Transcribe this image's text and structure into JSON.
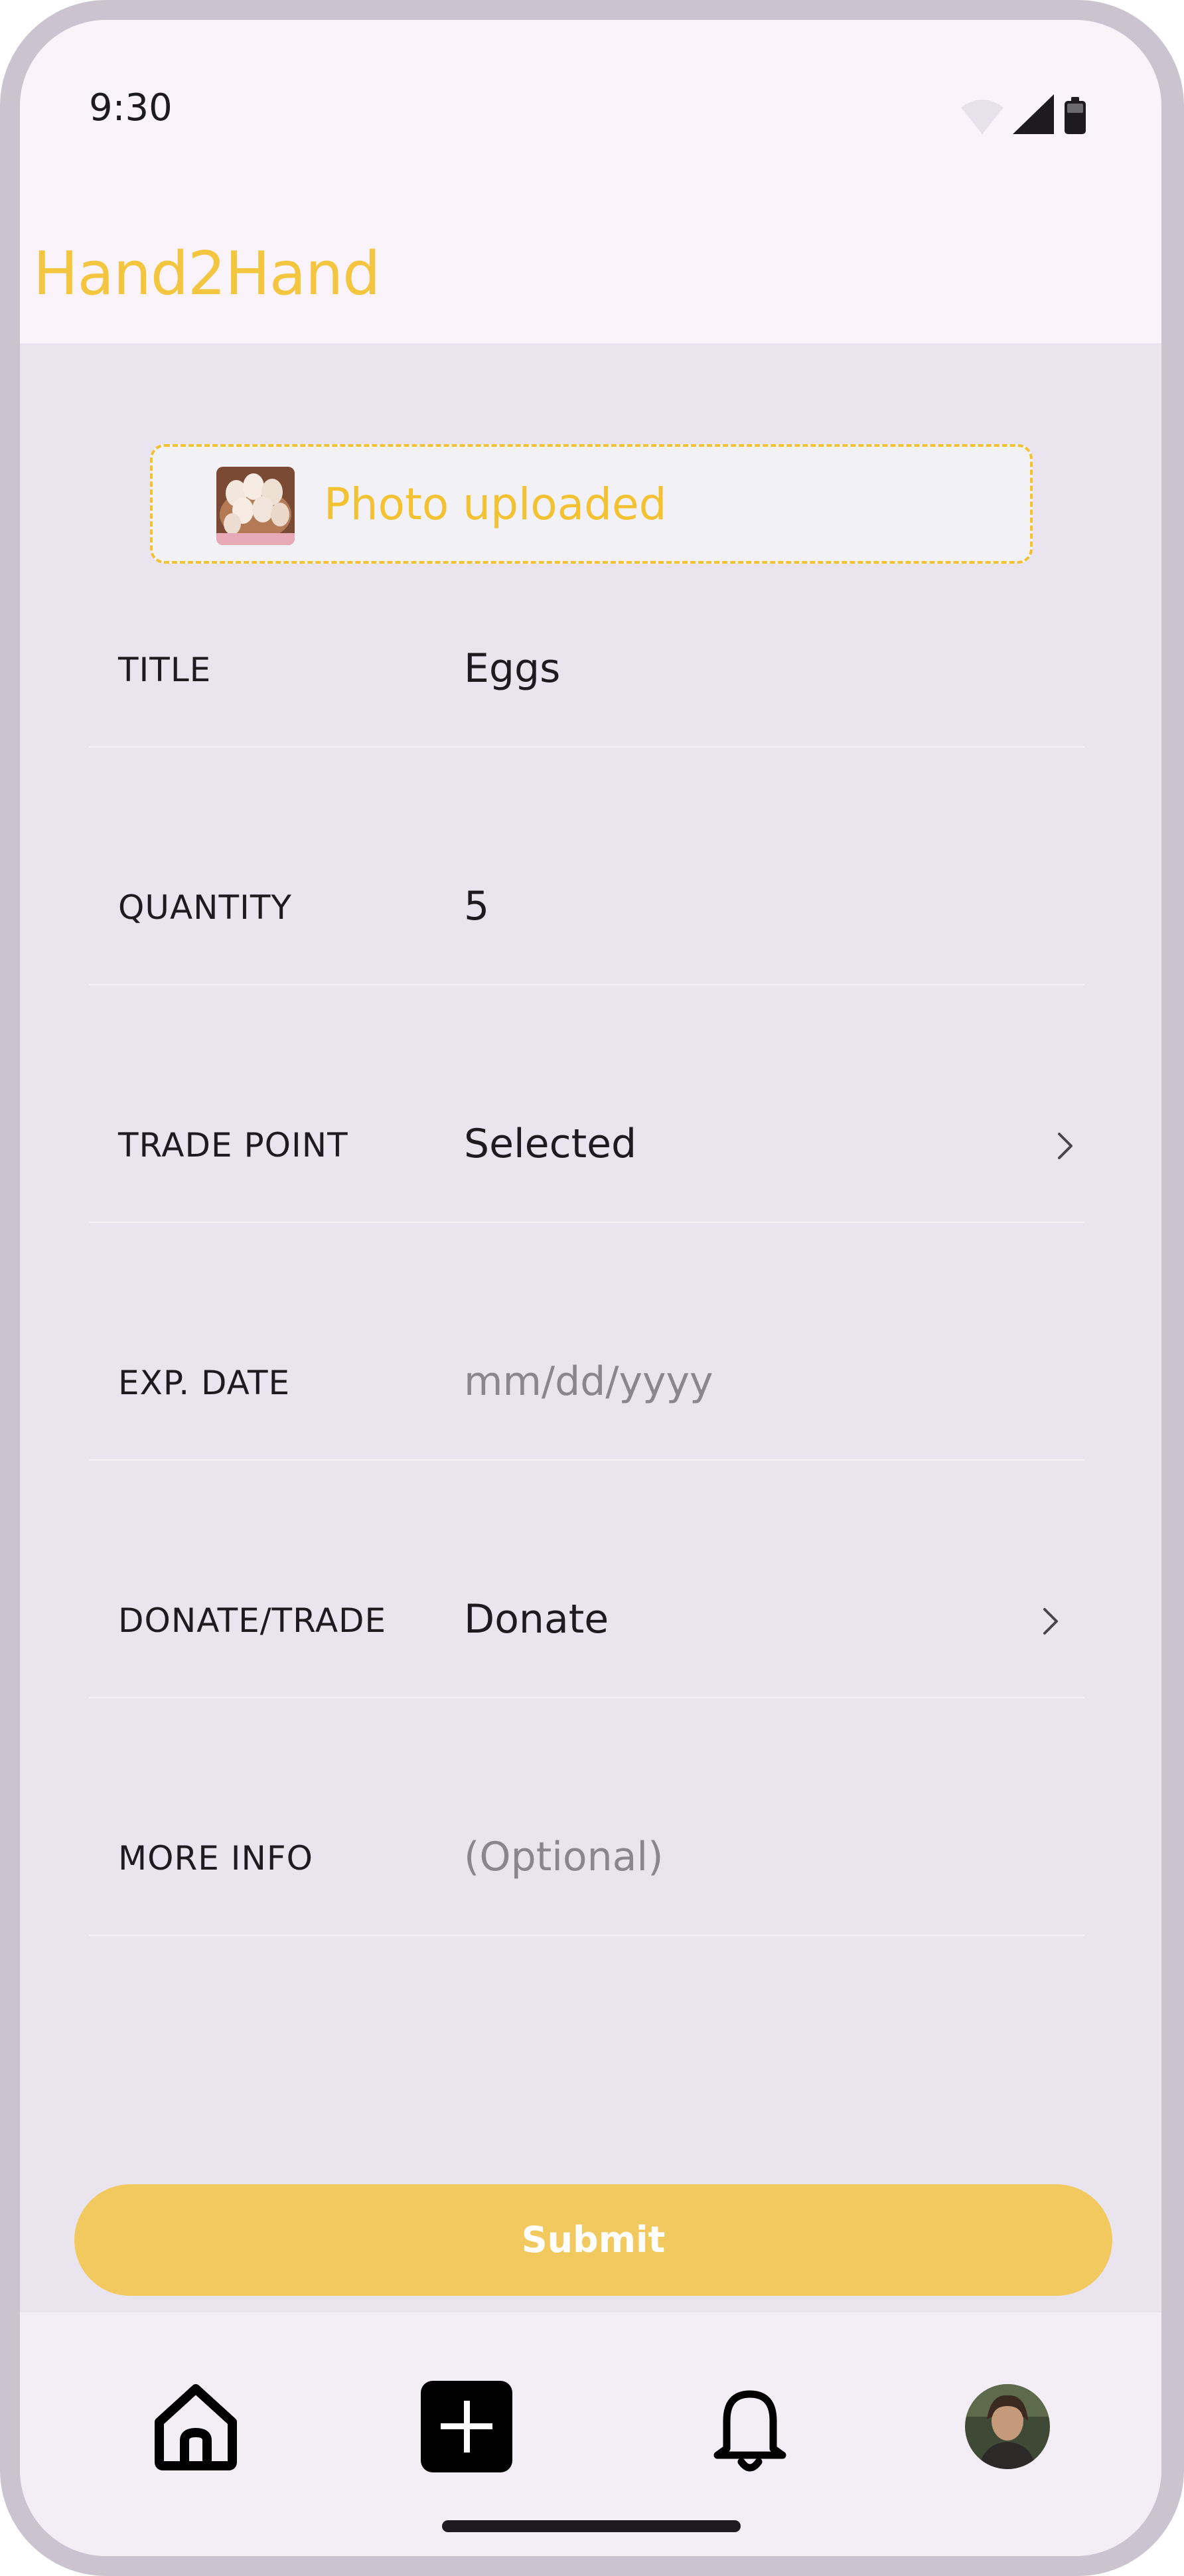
{
  "status_bar": {
    "time": "9:30",
    "icons": [
      "wifi-icon",
      "signal-icon",
      "battery-icon"
    ]
  },
  "app_bar": {
    "title": "Hand2Hand"
  },
  "upload": {
    "label": "Photo uploaded",
    "thumbnail": "eggs-photo"
  },
  "form": {
    "rows": [
      {
        "label": "TITLE",
        "value": "Eggs",
        "placeholder": false,
        "chevron": false
      },
      {
        "label": "QUANTITY",
        "value": "5",
        "placeholder": false,
        "chevron": false
      },
      {
        "label": "TRADE POINT",
        "value": "Selected",
        "placeholder": false,
        "chevron": true
      },
      {
        "label": "EXP. DATE",
        "value": "mm/dd/yyyy",
        "placeholder": true,
        "chevron": false
      },
      {
        "label": "DONATE/TRADE",
        "value": "Donate",
        "placeholder": false,
        "chevron": true
      },
      {
        "label": "MORE INFO",
        "value": "(Optional)",
        "placeholder": true,
        "chevron": false
      }
    ]
  },
  "submit": {
    "label": "Submit"
  },
  "nav": {
    "items": [
      "home-icon",
      "add-icon",
      "bell-icon",
      "avatar"
    ]
  },
  "colors": {
    "accent": "#f4c53e",
    "submit_bg": "#f2c95f"
  }
}
